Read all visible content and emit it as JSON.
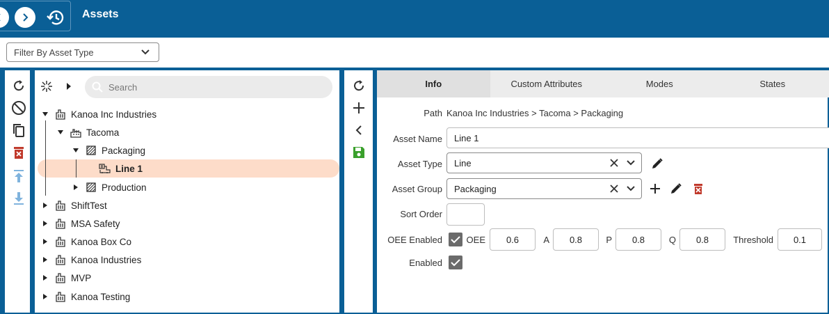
{
  "header": {
    "title": "Assets"
  },
  "filter": {
    "placeholder": "Filter By Asset Type"
  },
  "toolbar_left": {
    "icons": [
      "refresh-icon",
      "block-icon",
      "copy-icon",
      "delete-icon",
      "move-up-icon",
      "move-down-icon"
    ]
  },
  "tree": {
    "search_placeholder": "Search",
    "nodes": [
      {
        "label": "Kanoa Inc Industries",
        "icon": "enterprise-icon",
        "expanded": true
      },
      {
        "label": "Tacoma",
        "icon": "site-icon",
        "expanded": true
      },
      {
        "label": "Packaging",
        "icon": "area-icon",
        "expanded": true
      },
      {
        "label": "Line 1",
        "icon": "line-icon",
        "selected": true
      },
      {
        "label": "Production",
        "icon": "area-icon",
        "expanded": false
      },
      {
        "label": "ShiftTest",
        "icon": "enterprise-icon",
        "expanded": false
      },
      {
        "label": "MSA Safety",
        "icon": "enterprise-icon",
        "expanded": false
      },
      {
        "label": "Kanoa Box Co",
        "icon": "enterprise-icon",
        "expanded": false
      },
      {
        "label": "Kanoa Industries",
        "icon": "enterprise-icon",
        "expanded": false
      },
      {
        "label": "MVP",
        "icon": "enterprise-icon",
        "expanded": false
      },
      {
        "label": "Kanoa Testing",
        "icon": "enterprise-icon",
        "expanded": false
      }
    ]
  },
  "toolbar_mid": {
    "icons": [
      "refresh-icon",
      "add-icon",
      "collapse-icon",
      "save-icon"
    ]
  },
  "tabs": [
    "Info",
    "Custom Attributes",
    "Modes",
    "States"
  ],
  "form": {
    "path_label": "Path",
    "path_value": "Kanoa Inc Industries > Tacoma > Packaging",
    "asset_name_label": "Asset Name",
    "asset_name_value": "Line 1",
    "asset_type_label": "Asset Type",
    "asset_type_value": "Line",
    "asset_group_label": "Asset Group",
    "asset_group_value": "Packaging",
    "sort_order_label": "Sort Order",
    "sort_order_value": "",
    "oee_enabled_label": "OEE Enabled",
    "oee_enabled": true,
    "oee_label": "OEE",
    "oee_value": "0.6",
    "a_label": "A",
    "a_value": "0.8",
    "p_label": "P",
    "p_value": "0.8",
    "q_label": "Q",
    "q_value": "0.8",
    "threshold_label": "Threshold",
    "threshold_value": "0.1",
    "enabled_label": "Enabled",
    "enabled": true
  },
  "colors": {
    "brand": "#0a5f96",
    "selected_row": "#fddcc9",
    "save": "#3aa02c",
    "delete": "#c0392b",
    "move_arrows": "#7fb3dd"
  }
}
